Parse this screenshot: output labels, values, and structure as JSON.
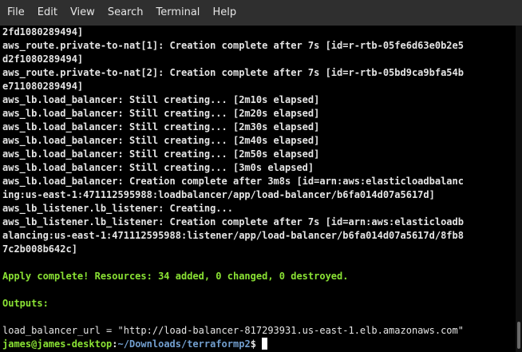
{
  "menu": [
    "File",
    "Edit",
    "View",
    "Search",
    "Terminal",
    "Help"
  ],
  "output": [
    {
      "text": "2fd1080289494]",
      "style": ""
    },
    {
      "text": "aws_route.private-to-nat[1]: Creation complete after 7s [id=r-rtb-05fe6d63e0b2e5",
      "style": ""
    },
    {
      "text": "d2f1080289494]",
      "style": ""
    },
    {
      "text": "aws_route.private-to-nat[2]: Creation complete after 7s [id=r-rtb-05bd9ca9bfa54b",
      "style": ""
    },
    {
      "text": "e71108028949 4]",
      "style": ""
    },
    {
      "text": "aws_lb.load_balancer: Still creating... [2m10s elapsed]",
      "style": ""
    },
    {
      "text": "aws_lb.load_balancer: Still creating... [2m20s elapsed]",
      "style": ""
    },
    {
      "text": "aws_lb.load_balancer: Still creating... [2m30s elapsed]",
      "style": ""
    },
    {
      "text": "aws_lb.load_balancer: Still creating... [2m40s elapsed]",
      "style": ""
    },
    {
      "text": "aws_lb.load_balancer: Still creating... [2m50s elapsed]",
      "style": ""
    },
    {
      "text": "aws_lb.load_balancer: Still creating... [3m0s elapsed]",
      "style": ""
    },
    {
      "text": "aws_lb.load_balancer: Creation complete after 3m8s [id=arn:aws:elasticloadbalanc",
      "style": ""
    },
    {
      "text": "ing:us-east-1:471112595988:loadbalancer/app/load-balancer/b6fa014d07a5617d]",
      "style": ""
    },
    {
      "text": "aws_lb_listener.lb_listener: Creating...",
      "style": ""
    },
    {
      "text": "aws_lb_listener.lb_listener: Creation complete after 7s [id=arn:aws:elasticloadb",
      "style": ""
    },
    {
      "text": "alancing:us-east-1:471112595988:listener/app/load-balancer/b6fa014d07a5617d/8fb8",
      "style": ""
    },
    {
      "text": "7c2b008b642c]",
      "style": ""
    },
    {
      "text": "",
      "style": ""
    },
    {
      "text": "Apply complete! Resources: 34 added, 0 changed, 0 destroyed.",
      "style": "green"
    },
    {
      "text": "",
      "style": ""
    },
    {
      "text": "Outputs:",
      "style": "green"
    },
    {
      "text": "",
      "style": ""
    },
    {
      "text": "load_balancer_url = \"http://load-balancer-817293931.us-east-1.elb.amazonaws.com\"",
      "style": "plain"
    }
  ],
  "prompt": {
    "user_host": "james@james-desktop",
    "separator": ":",
    "path": "~/Downloads/terraformp2",
    "dollar": "$ "
  },
  "colors": {
    "background": "#000000",
    "text": "#e5e5e5",
    "green": "#8ae234",
    "path_blue": "#729fcf",
    "menubar": "#2f2f2f"
  }
}
